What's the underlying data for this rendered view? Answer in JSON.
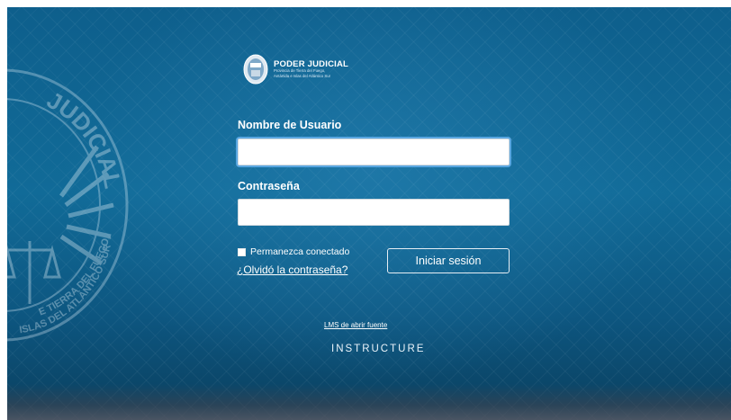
{
  "brand": {
    "title": "PODER JUDICIAL",
    "subtitle_line1": "Provincia de Tierra del Fuego,",
    "subtitle_line2": "Antártida e Islas del Atlántico Sur"
  },
  "seal": {
    "text_top": "JUDICIAL",
    "text_bottom1": "E TIERRA DEL FUEGO,",
    "text_bottom2": "ISLAS DEL ATLÁNTICO SUR"
  },
  "form": {
    "username_label": "Nombre de Usuario",
    "username_value": "",
    "password_label": "Contraseña",
    "password_value": "",
    "remember_label": "Permanezca conectado",
    "remember_checked": false,
    "forgot_label": "¿Olvidó la contraseña?",
    "submit_label": "Iniciar sesión"
  },
  "footer": {
    "oss_link": "LMS de abrir fuente",
    "brand": "INSTRUCTURE"
  },
  "colors": {
    "background": "#0e5f8c",
    "focus_ring": "#58a6e0",
    "text": "#ffffff"
  }
}
